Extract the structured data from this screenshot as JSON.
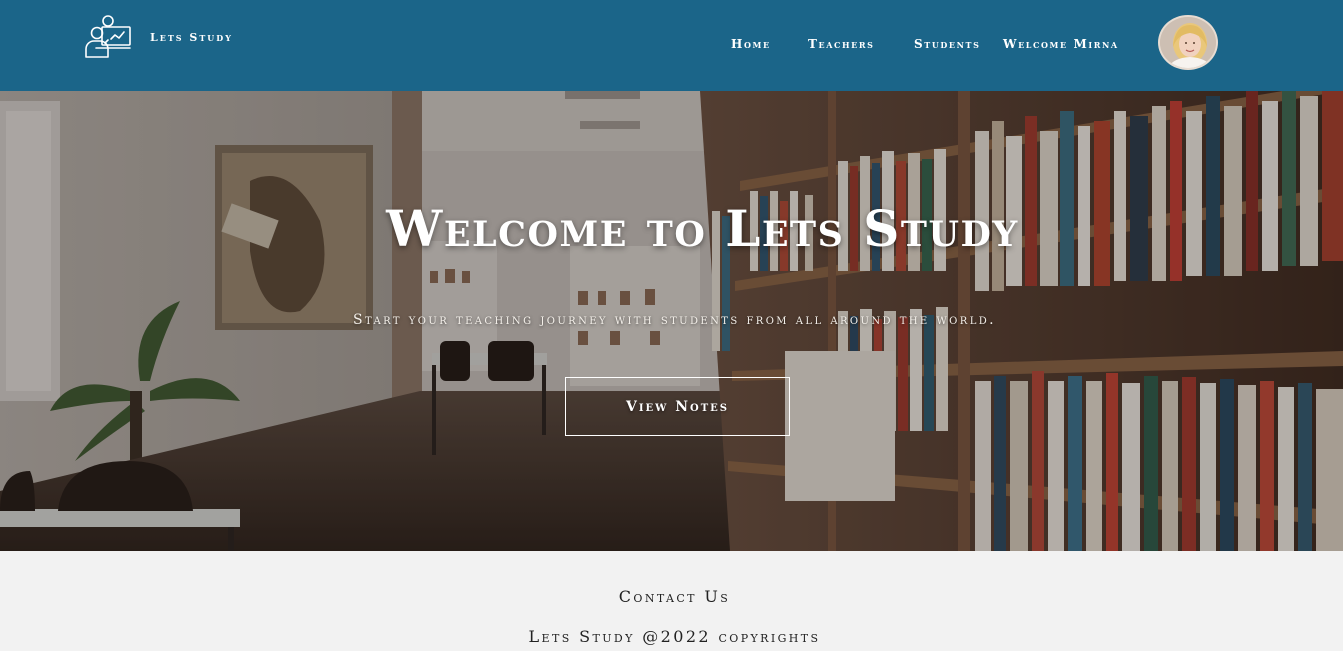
{
  "brand": {
    "logo_icon": "teacher-presentation-icon",
    "name": "Lets Study"
  },
  "nav": {
    "home": "Home",
    "teachers": "Teachers",
    "students": "Students",
    "welcome": "Welcome Mirna"
  },
  "user": {
    "avatar_icon": "user-avatar"
  },
  "hero": {
    "title": "Welcome to Lets Study",
    "subtitle": "Start your teaching journey with students from all around the world.",
    "button_label": "View Notes",
    "background": "library-bookshelves-photo"
  },
  "footer": {
    "contact": "Contact Us",
    "copyright": "Lets Study @2022 copyrights"
  },
  "colors": {
    "header_bg": "#1b6589",
    "footer_bg": "#f2f2f2",
    "text_light": "#ffffff",
    "text_dark": "#222222"
  }
}
